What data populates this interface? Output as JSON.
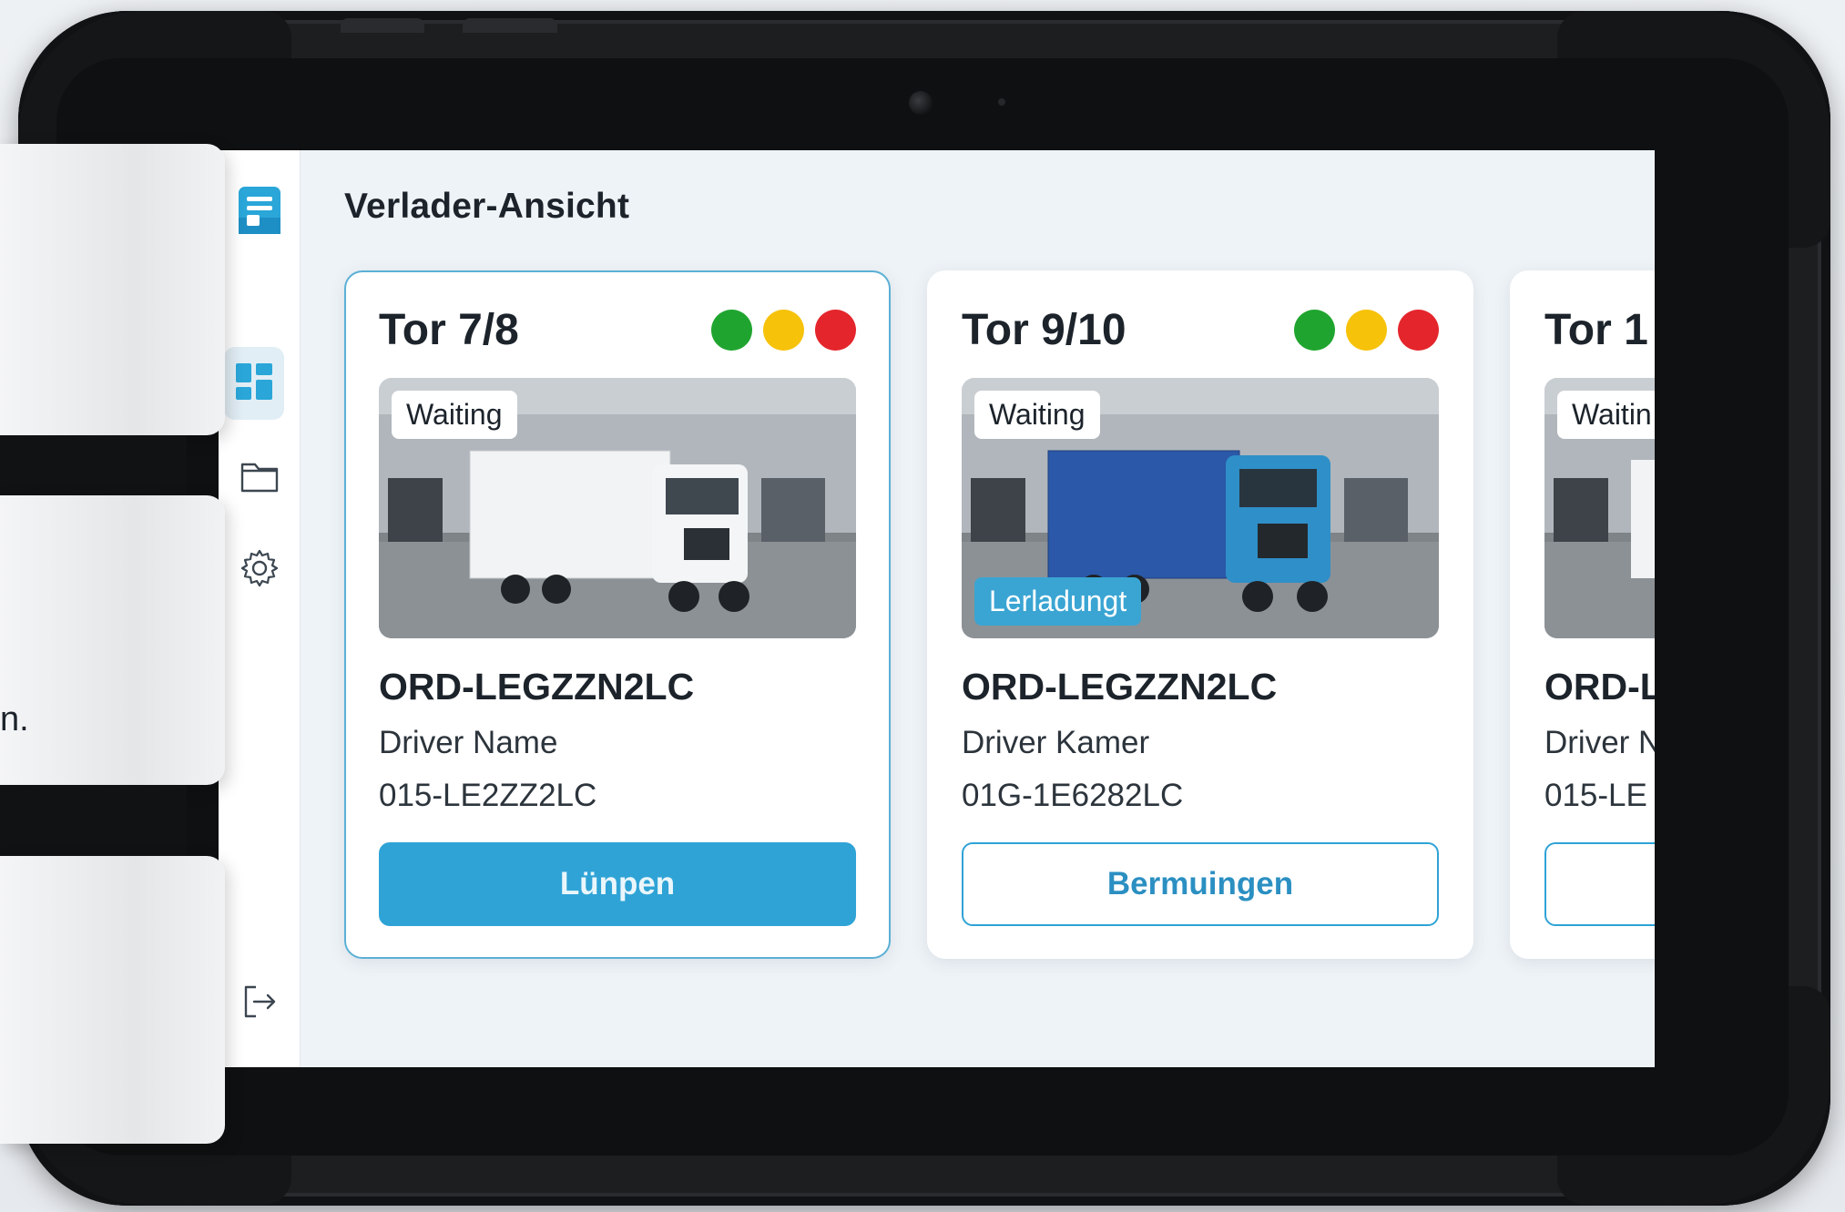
{
  "app": {
    "title": "Verlader-Ansicht"
  },
  "nav": {
    "items": [
      {
        "name": "logo",
        "icon": "app-logo-icon"
      },
      {
        "name": "dashboard",
        "icon": "dashboard-grid-icon",
        "active": true
      },
      {
        "name": "folder",
        "icon": "folder-icon"
      },
      {
        "name": "settings",
        "icon": "gear-icon"
      },
      {
        "name": "logout",
        "icon": "logout-icon"
      }
    ]
  },
  "cards": [
    {
      "gate": "Tor 7/8",
      "status_chip": "Waiting",
      "loading_chip": "",
      "order_id": "ORD-LEGZZN2LC",
      "driver": "Driver Name",
      "phone": "015-LE2ZZ2LC",
      "action_label": "Lünpen",
      "action_style": "primary",
      "truck_color": "#f2f3f4",
      "selected": true
    },
    {
      "gate": "Tor 9/10",
      "status_chip": "Waiting",
      "loading_chip": "Lerladungt",
      "order_id": "ORD-LEGZZN2LC",
      "driver": "Driver Kamer",
      "phone": "01G-1E6282LC",
      "action_label": "Bermuingen",
      "action_style": "outline",
      "truck_color": "#2f8fc8",
      "selected": false
    },
    {
      "gate": "Tor 1",
      "status_chip": "Waitin",
      "loading_chip": "",
      "order_id": "ORD-L",
      "driver": "Driver N",
      "phone": "015-LE",
      "action_label": "",
      "action_style": "outline",
      "truck_color": "#f2f3f4",
      "selected": false
    }
  ],
  "traffic_light_colors": {
    "green": "#1fa52f",
    "yellow": "#f6c20a",
    "red": "#e4262c"
  },
  "overlay": {
    "fragment_text": "n."
  }
}
